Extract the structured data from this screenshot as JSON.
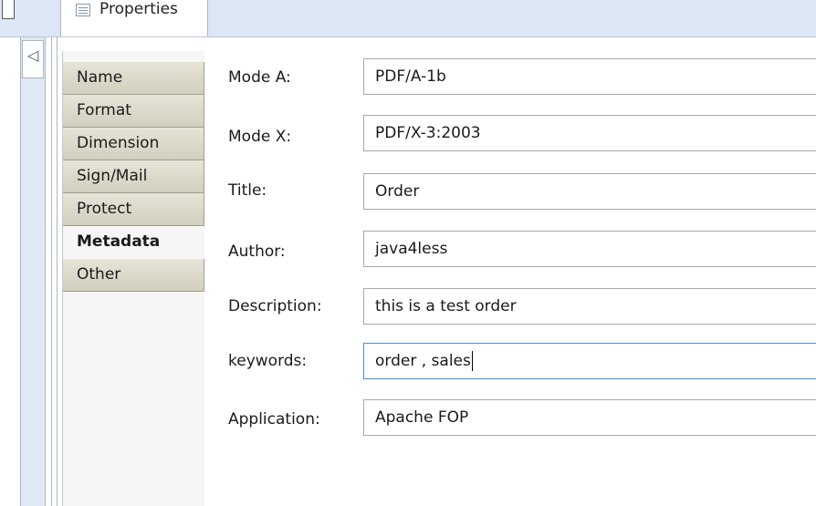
{
  "tab": {
    "label": "Properties"
  },
  "nav": {
    "items": [
      {
        "label": "Name",
        "active": false
      },
      {
        "label": "Format",
        "active": false
      },
      {
        "label": "Dimension",
        "active": false
      },
      {
        "label": "Sign/Mail",
        "active": false
      },
      {
        "label": "Protect",
        "active": false
      },
      {
        "label": "Metadata",
        "active": true
      },
      {
        "label": "Other",
        "active": false
      }
    ]
  },
  "form": {
    "fields": [
      {
        "label": "Mode A:",
        "value": "PDF/A-1b"
      },
      {
        "label": "Mode X:",
        "value": "PDF/X-3:2003"
      },
      {
        "label": "Title:",
        "value": "Order"
      },
      {
        "label": "Author:",
        "value": "java4less"
      },
      {
        "label": "Description:",
        "value": "this is a test order"
      },
      {
        "label": "keywords:",
        "value": "order , sales",
        "focused": true
      },
      {
        "label": "Application:",
        "value": "Apache FOP"
      }
    ]
  },
  "colors": {
    "tab_strip": "#dce6f4",
    "nav_tab": "#dedbcb",
    "focus_border": "#4a90d9"
  }
}
